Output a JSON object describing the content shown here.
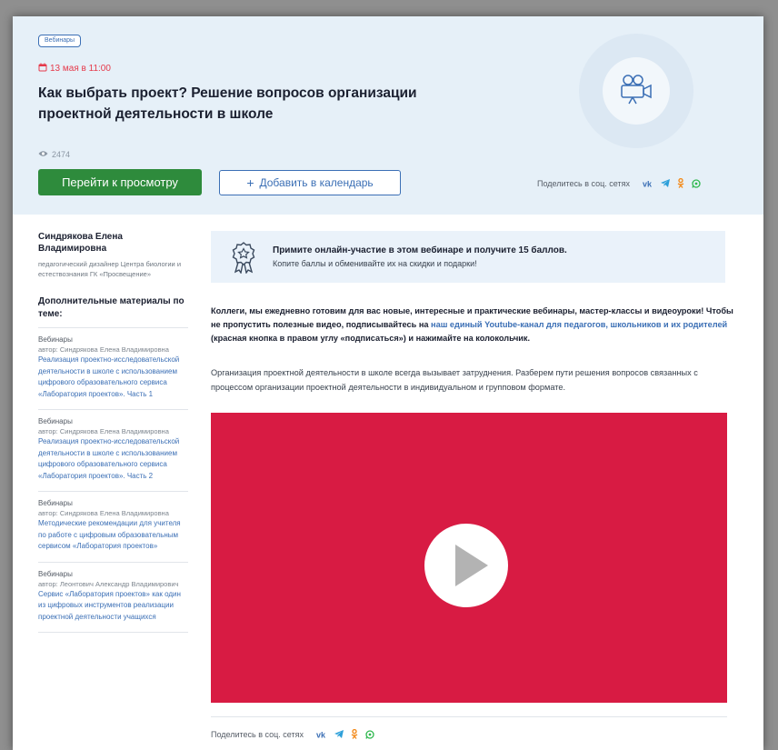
{
  "header": {
    "badge": "Вебинары",
    "date": "13 мая в 11:00",
    "title": "Как выбрать проект? Решение вопросов организации проектной деятельности в школе",
    "views": "2474",
    "watch_button": "Перейти к просмотру",
    "calendar_button": "Добавить в календарь",
    "share_label": "Поделитесь в соц. сетях"
  },
  "sidebar": {
    "author_name": "Синдрякова Елена Владимировна",
    "author_role": "педагогический дизайнер Центра биологии и естествознания ГК «Просвещение»",
    "more_title": "Дополнительные материалы по теме:",
    "materials": [
      {
        "category": "Вебинары",
        "author": "автор: Синдрякова Елена Владимировна",
        "title": "Реализация проектно-исследовательской деятельности в школе с использованием цифрового образовательного сервиса «Лаборатория проектов». Часть 1"
      },
      {
        "category": "Вебинары",
        "author": "автор: Синдрякова Елена Владимировна",
        "title": "Реализация проектно-исследовательской деятельности в школе с использованием цифрового образовательного сервиса «Лаборатория проектов». Часть 2"
      },
      {
        "category": "Вебинары",
        "author": "автор: Синдрякова Елена Владимировна",
        "title": "Методические рекомендации для учителя по работе с цифровым образовательным сервисом «Лаборатория проектов»"
      },
      {
        "category": "Вебинары",
        "author": "автор: Леонтович Александр Владимирович",
        "title": "Сервис «Лаборатория проектов» как один из цифровых инструментов реализации проектной деятельности учащихся"
      }
    ]
  },
  "promo": {
    "headline": "Примите онлайн-участие в этом вебинаре и получите 15 баллов.",
    "subline": "Копите баллы и обменивайте их на скидки и подарки!"
  },
  "content": {
    "p1_start": "Коллеги, мы ежедневно готовим для вас новые, интересные и практические вебинары, мастер-классы и видеоуроки! Чтобы не пропустить полезные видео, подписывайтесь на ",
    "p1_link": "наш единый Youtube-канал для педагогов, школьников и их родителей",
    "p1_end": " (красная кнопка в правом углу «подписаться») и нажимайте на колокольчик.",
    "p2": "Организация проектной деятельности в школе всегда вызывает затруднения. Разберем пути решения вопросов связанных с процессом организации проектной деятельности в индивидуальном и групповом формате."
  },
  "footer": {
    "share_label": "Поделитесь в соц. сетях"
  },
  "colors": {
    "accent_blue": "#3b6fb5",
    "watch_green": "#2e8b3c",
    "video_red": "#d81b43",
    "date_red": "#e53a4b",
    "hero_bg": "#e6f0f8"
  },
  "icons": {
    "date": "calendar-icon",
    "views": "eye-icon",
    "calendar_add": "plus-icon",
    "webinar": "video-camera-icon",
    "promo": "award-ribbon-icon",
    "play": "play-icon",
    "social": [
      "vk-icon",
      "telegram-icon",
      "odnoklassniki-icon",
      "whatsapp-icon"
    ]
  }
}
